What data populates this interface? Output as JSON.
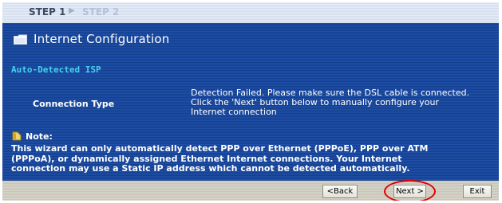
{
  "steps": {
    "current": "STEP 1",
    "next": "STEP 2"
  },
  "page": {
    "title": "Internet Configuration",
    "section": "Auto-Detected ISP"
  },
  "connection": {
    "label": "Connection Type",
    "value": "Detection Failed. Please make sure the DSL cable is connected.\nClick the 'Next' button below to manually configure your\nInternet connection"
  },
  "note": {
    "label": "Note:",
    "text": "This wizard can only automatically detect PPP over Ethernet (PPPoE), PPP over ATM\n(PPPoA), or dynamically assigned Ethernet Internet connections. Your Internet\nconnection may use a Static IP address which cannot be detected automatically."
  },
  "buttons": {
    "back": "<Back",
    "next": "Next >",
    "exit": "Exit"
  },
  "colors": {
    "background": "#17429a",
    "section_heading": "#46d0f2",
    "highlight": "#e30000"
  },
  "icons": {
    "title": "folder-icon",
    "note": "note-icon"
  }
}
